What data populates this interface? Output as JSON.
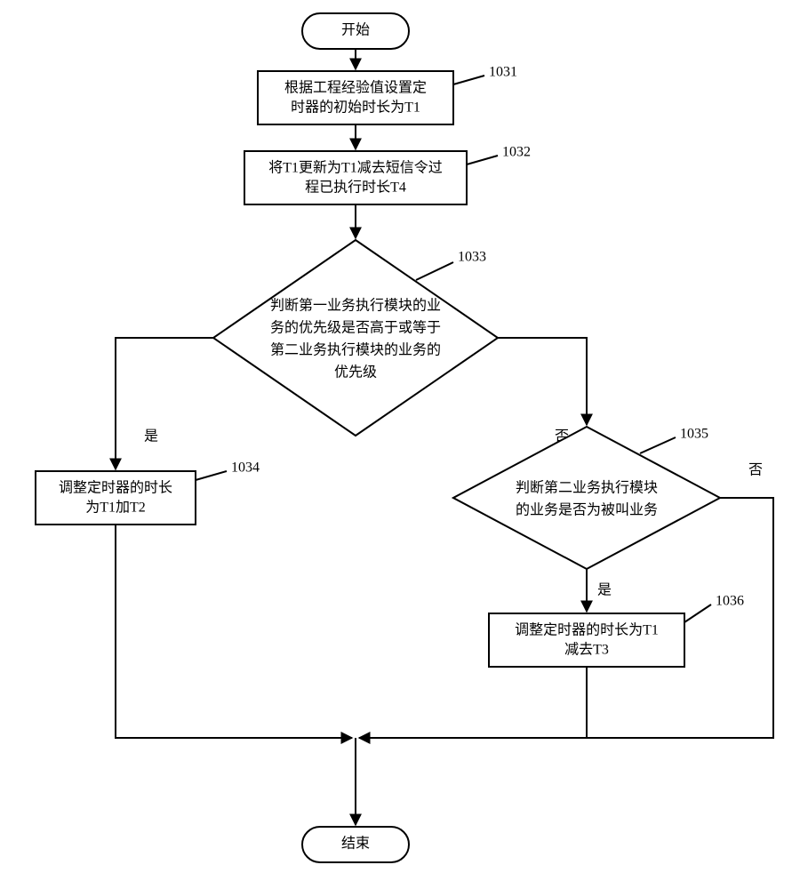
{
  "chart_data": {
    "type": "flowchart",
    "title": "",
    "nodes": {
      "start": {
        "kind": "terminator",
        "text": "开始"
      },
      "n1031": {
        "kind": "process",
        "text_lines": [
          "根据工程经验值设置定",
          "时器的初始时长为T1"
        ],
        "tag": "1031"
      },
      "n1032": {
        "kind": "process",
        "text_lines": [
          "将T1更新为T1减去短信令过",
          "程已执行时长T4"
        ],
        "tag": "1032"
      },
      "n1033": {
        "kind": "decision",
        "text_lines": [
          "判断第一业务执行模块的业",
          "务的优先级是否高于或等于",
          "第二业务执行模块的业务的",
          "优先级"
        ],
        "tag": "1033"
      },
      "n1034": {
        "kind": "process",
        "text_lines": [
          "调整定时器的时长",
          "为T1加T2"
        ],
        "tag": "1034"
      },
      "n1035": {
        "kind": "decision",
        "text_lines": [
          "判断第二业务执行模块",
          "的业务是否为被叫业务"
        ],
        "tag": "1035"
      },
      "n1036": {
        "kind": "process",
        "text_lines": [
          "调整定时器的时长为T1",
          "减去T3"
        ],
        "tag": "1036"
      },
      "end": {
        "kind": "terminator",
        "text": "结束"
      }
    },
    "edges": [
      {
        "from": "start",
        "to": "n1031"
      },
      {
        "from": "n1031",
        "to": "n1032"
      },
      {
        "from": "n1032",
        "to": "n1033"
      },
      {
        "from": "n1033",
        "to": "n1034",
        "label": "是"
      },
      {
        "from": "n1033",
        "to": "n1035",
        "label": "否"
      },
      {
        "from": "n1035",
        "to": "n1036",
        "label": "是"
      },
      {
        "from": "n1035",
        "to": "merge",
        "label": "否"
      },
      {
        "from": "n1034",
        "to": "merge"
      },
      {
        "from": "n1036",
        "to": "merge"
      },
      {
        "from": "merge",
        "to": "end"
      }
    ]
  },
  "labels": {
    "yes": "是",
    "no": "否"
  }
}
